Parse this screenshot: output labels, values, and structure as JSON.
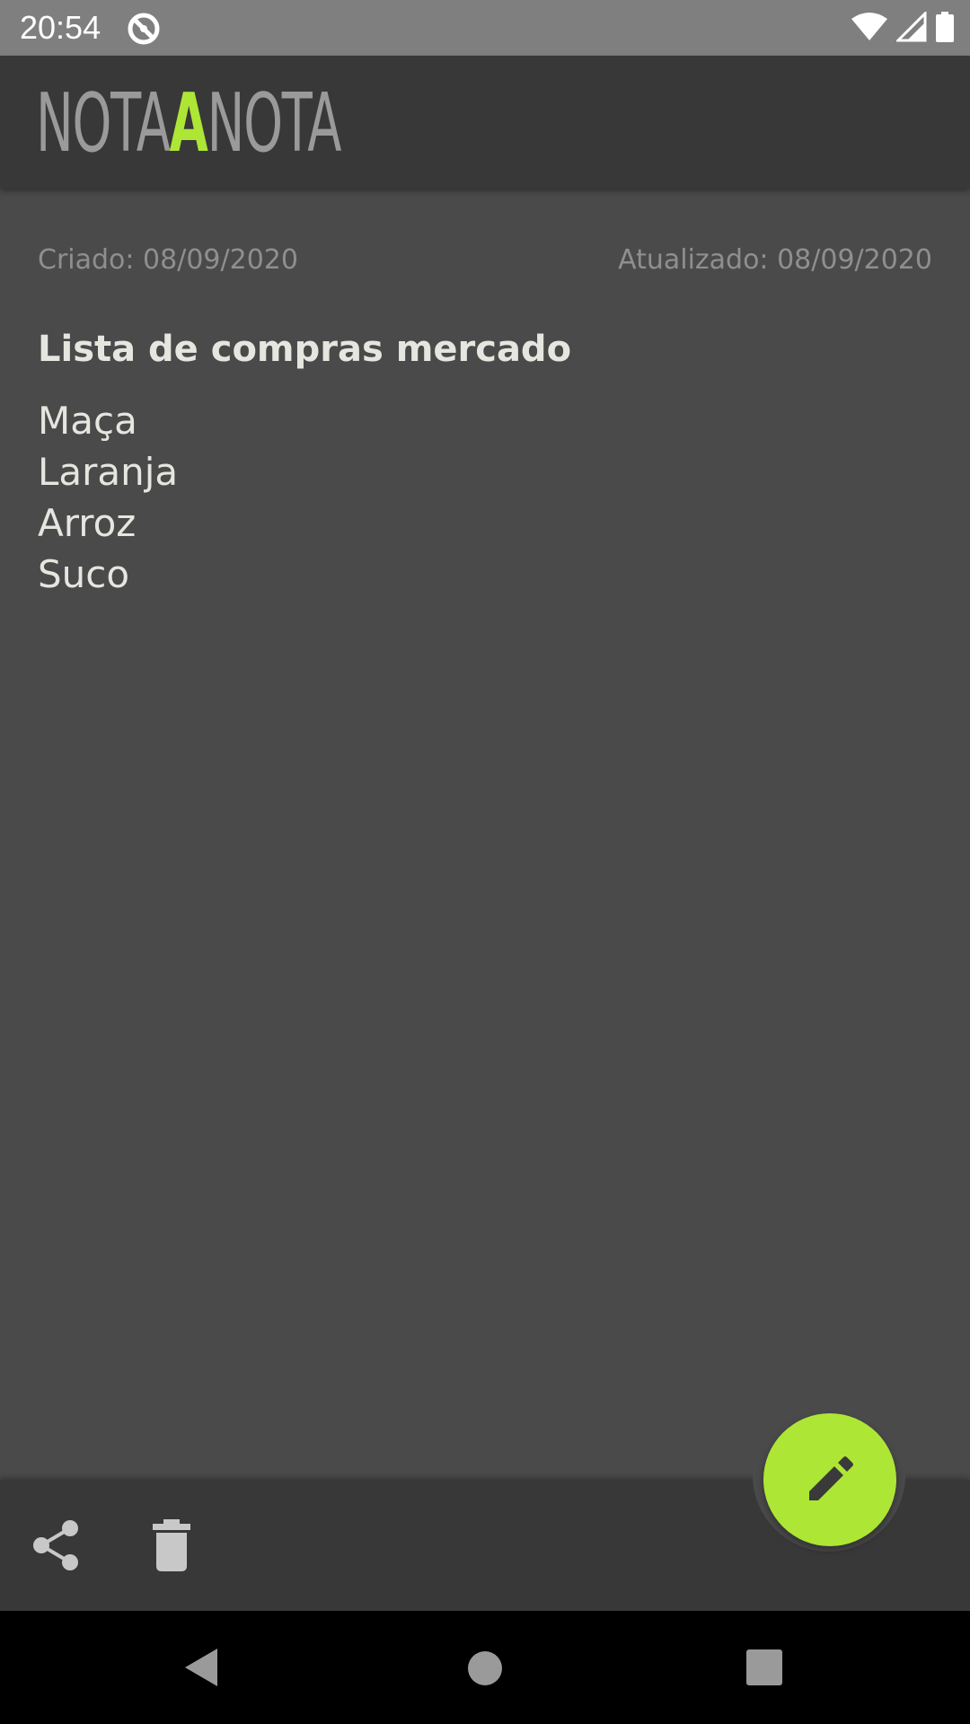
{
  "status_bar": {
    "time": "20:54",
    "icons": [
      "do-not-disturb-icon",
      "wifi-icon",
      "signal-icon",
      "battery-icon"
    ]
  },
  "app_bar": {
    "logo": {
      "part1": "NOTA",
      "part2": "A",
      "part3": "NOTA"
    }
  },
  "note": {
    "created": "Criado: 08/09/2020",
    "updated": "Atualizado: 08/09/2020",
    "title": "Lista de compras mercado",
    "body": "Maça\nLaranja\nArroz\nSuco"
  },
  "bottom_bar": {
    "actions": [
      "share-icon",
      "delete-icon"
    ],
    "fab": "edit-icon"
  },
  "nav_bar": {
    "buttons": [
      "back-icon",
      "home-icon",
      "recents-icon"
    ]
  },
  "colors": {
    "accent": "#aee636",
    "background": "#4a4a4a",
    "app_bar": "#383838",
    "status_bar": "#7f7f7f"
  }
}
